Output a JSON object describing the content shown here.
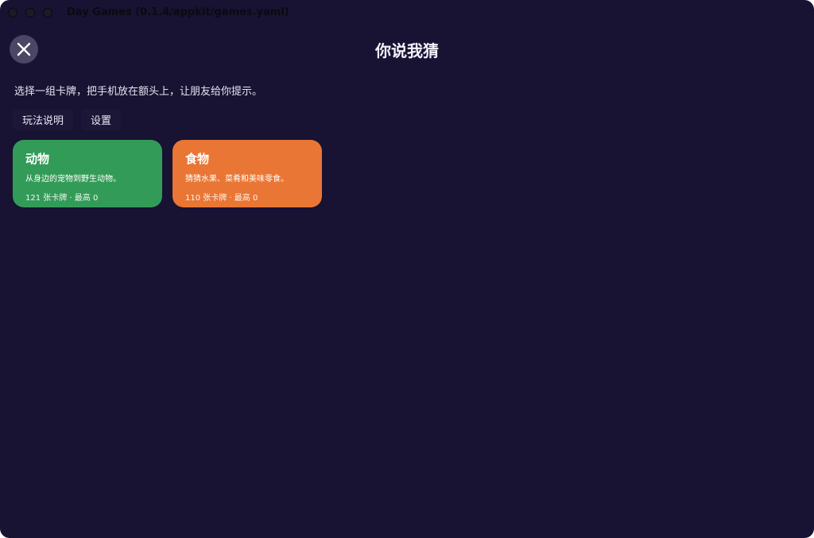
{
  "window": {
    "title": "Day Games (0.1.4/appkit/games.yaml)"
  },
  "header": {
    "title": "你说我猜",
    "close_icon": "close-icon"
  },
  "main": {
    "subtitle": "选择一组卡牌，把手机放在额头上，让朋友给你提示。",
    "links": [
      {
        "label": "玩法说明"
      },
      {
        "label": "设置"
      }
    ],
    "decks": [
      {
        "title": "动物",
        "description": "从身边的宠物到野生动物。",
        "meta": "121 张卡牌 · 最高 0",
        "color": "#339b58"
      },
      {
        "title": "食物",
        "description": "猜猜水果、菜肴和美味零食。",
        "meta": "110 张卡牌 · 最高 0",
        "color": "#e97634"
      }
    ]
  },
  "colors": {
    "background": "#181233",
    "close_button": "#4a4663"
  }
}
